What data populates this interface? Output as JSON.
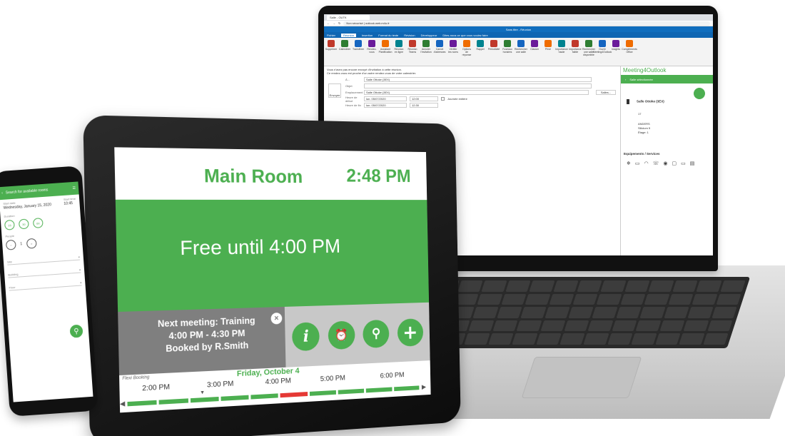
{
  "laptop": {
    "browser": {
      "tab_label": "Salle - OUTK",
      "address": "Non sécurisé | outlook.web.m4o.fr"
    },
    "outlook": {
      "title": "Sans titre - Réunion",
      "menu": [
        "Fichier",
        "Réunion",
        "Insertion",
        "Format du texte",
        "Révision",
        "Développeur",
        "Dites-nous ce que vous voulez faire"
      ],
      "ribbon": [
        "Supprimer",
        "Calendrier",
        "Transférer",
        "Rendez-vous",
        "Assistant Planification",
        "Réunion en ligne",
        "Réunion Teams",
        "Annuler l'invitation",
        "Carnet d'adresses",
        "Vérifier les noms",
        "Options de réponse",
        "Rappel",
        "Périodicité",
        "Fuseaux horaires",
        "Rechercher une salle",
        "Classer",
        "Privé",
        "Importance haute",
        "Importance faible",
        "Rechercher une salle disponible",
        "Ouvrir Meeting4Outlook",
        "Insights",
        "Compléments Office"
      ],
      "infobar": "Vous n'avez pas encore envoyé d'invitation à cette réunion.",
      "infobar2": "Ce rendez-vous est proche d'un autre rendez-vous de votre calendrier.",
      "send_label": "Envoyer",
      "fields": {
        "to_label": "À...",
        "to_value": "Salle Ottoke (3EX)",
        "subject_label": "Objet",
        "location_label": "Emplacement",
        "location_value": "Salle Ottoke (3EX)",
        "start_label": "Heure de début",
        "start_date": "lun. 05/07/2020",
        "start_time": "12:00",
        "allday_label": "Journée entière",
        "end_label": "Heure de fin",
        "end_date": "lun. 05/07/2020",
        "end_time": "12:30",
        "salles_button": "Salles..."
      }
    },
    "m4o": {
      "title": "Meeting4Outlook",
      "bar_label": "Salle sélectionnée",
      "room": "Salle Ottoke (3EX)",
      "capacity": "17",
      "address_lines": [
        "ANDERS",
        "Silicium 5",
        "Étage: 1"
      ],
      "equipment_title": "Equipements / Services"
    }
  },
  "tablet": {
    "room": "Main Room",
    "time": "2:48 PM",
    "status": "Free until 4:00 PM",
    "next_meeting": [
      "Next meeting: Training",
      "4:00 PM - 4:30 PM",
      "Booked by R.Smith"
    ],
    "brand": "Flexi Booking",
    "date": "Friday, October 4",
    "hours": [
      "2:00 PM",
      "3:00 PM",
      "4:00 PM",
      "5:00 PM",
      "6:00 PM"
    ],
    "timeline_segments": [
      "free",
      "free",
      "free",
      "free",
      "free",
      "busy",
      "free",
      "free",
      "free",
      "free"
    ],
    "colors": {
      "accent": "#4caf50",
      "busy": "#e53935",
      "panel": "#7f7f7f"
    }
  },
  "phone": {
    "header": "Search for available rooms",
    "start_label": "Start date",
    "start_value": "Wednesday, January 15, 2020",
    "start_time_label": "Start time",
    "start_time_value": "10:45",
    "duration_label": "Duration",
    "duration_options": [
      "15",
      "30",
      "60"
    ],
    "people_label": "People",
    "people_value": "1",
    "site_label": "Site",
    "building_label": "Building",
    "floor_label": "Floor"
  }
}
